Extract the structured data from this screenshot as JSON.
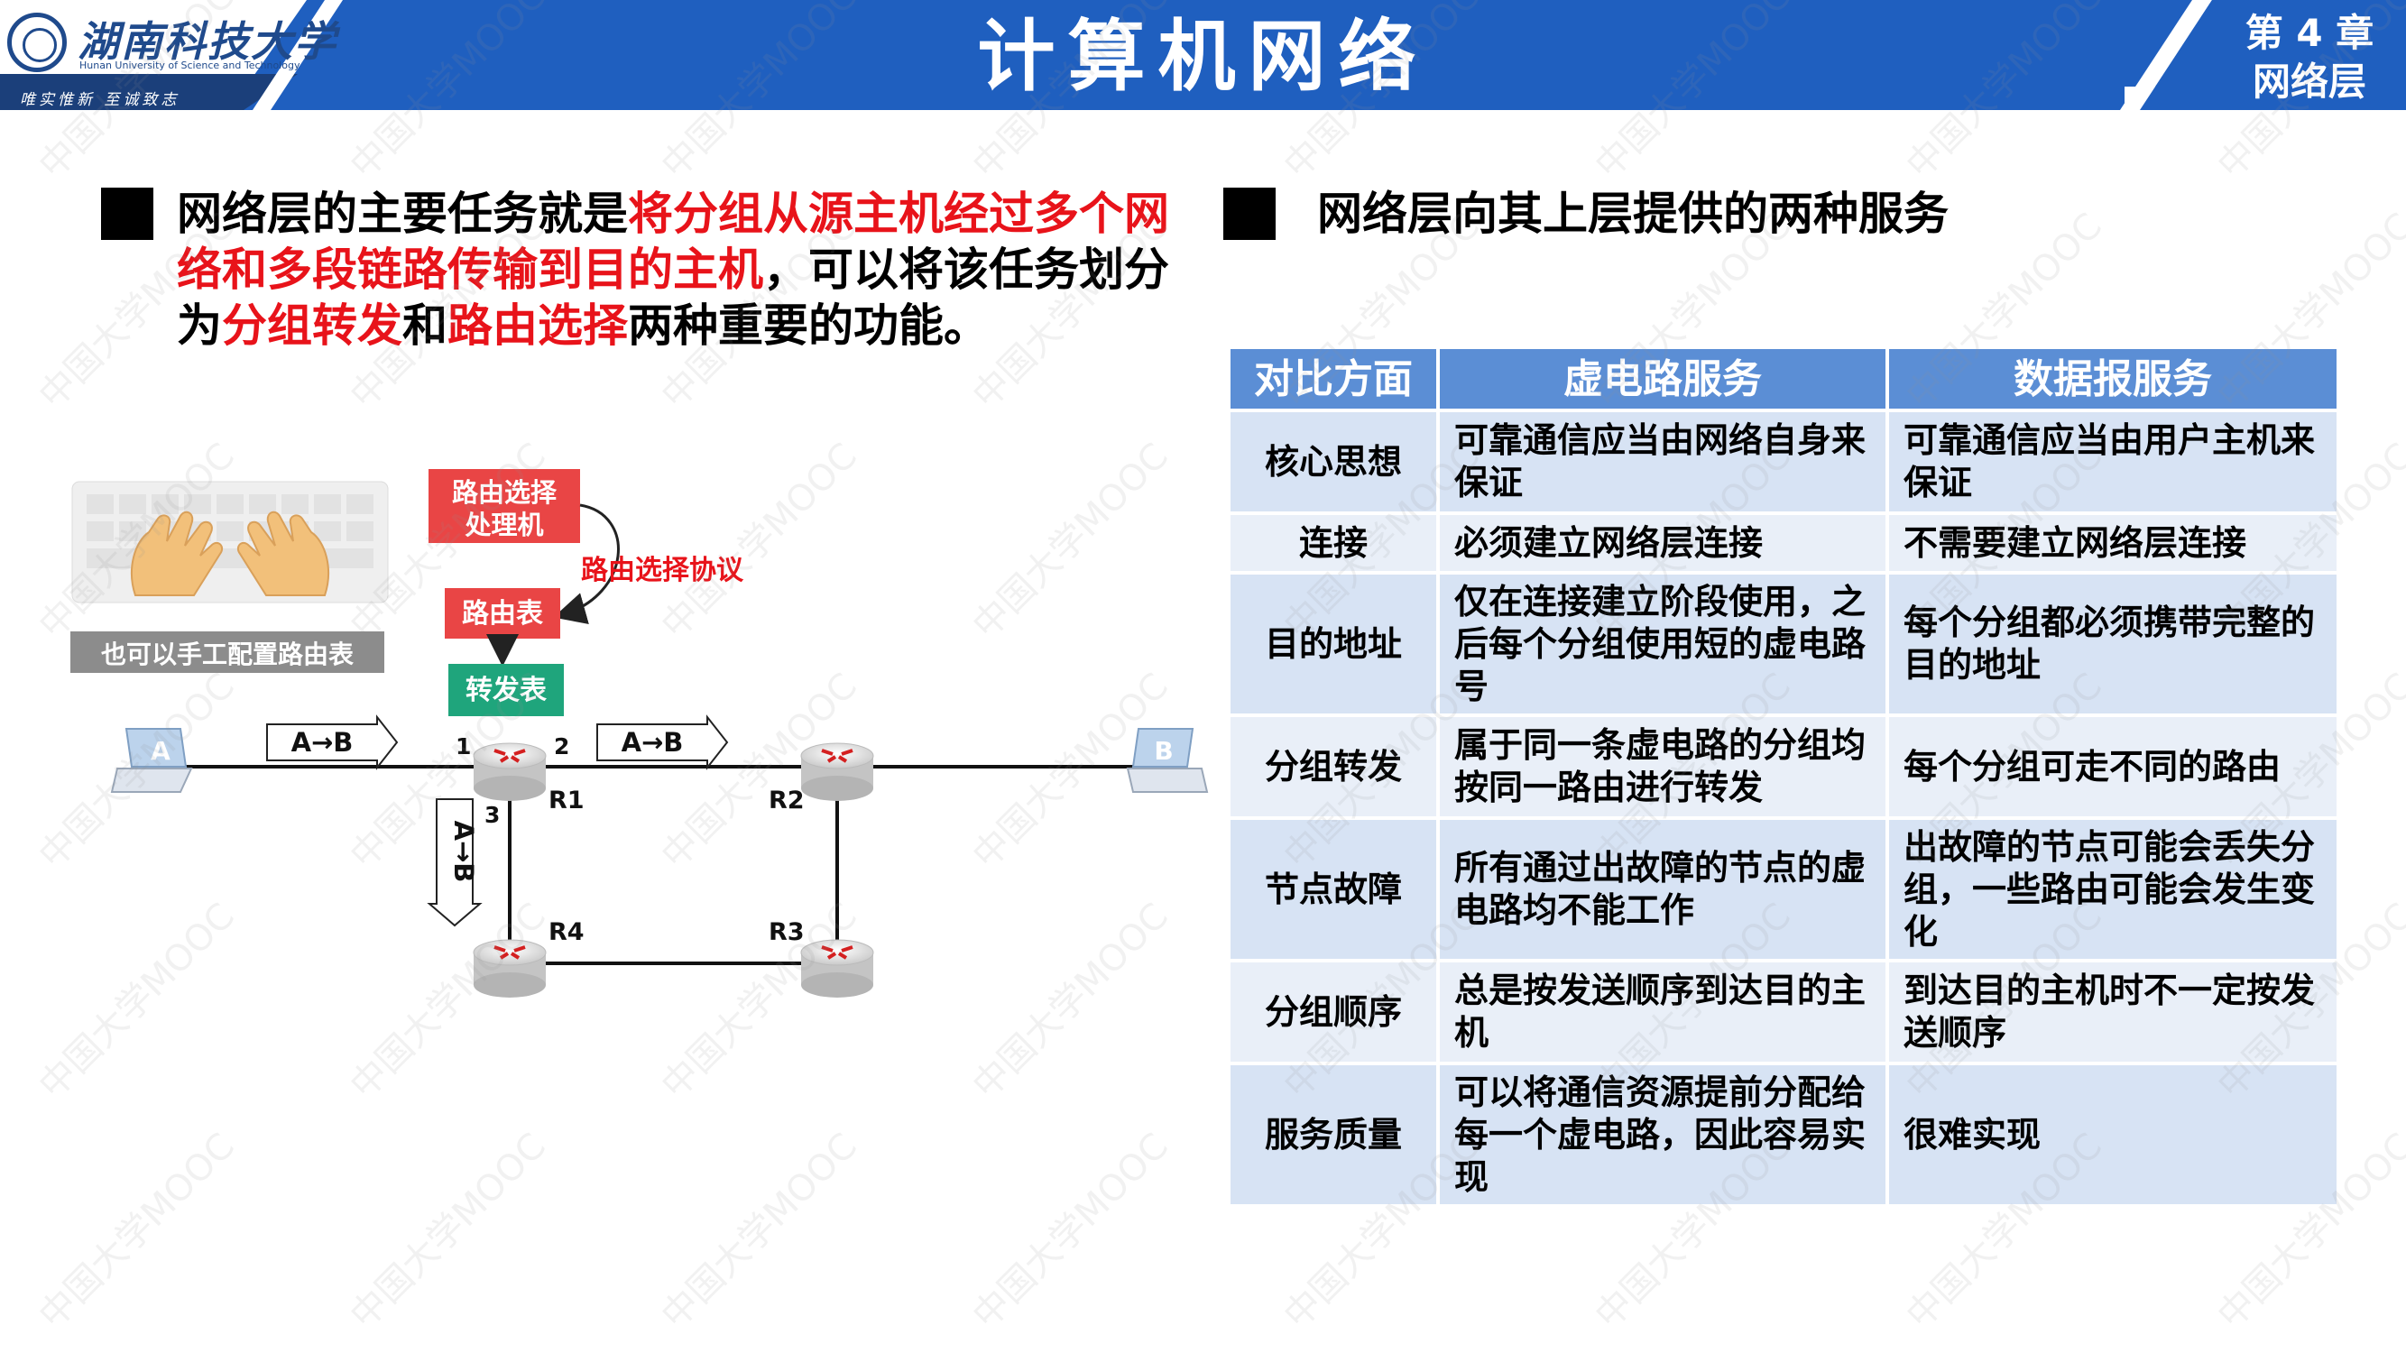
{
  "header": {
    "school_name": "湖南科技大学",
    "school_english": "Hunan University of Science and Technology",
    "motto": "唯实惟新  至诚致志",
    "title": "计算机网络",
    "chapter_line1": "第 4 章",
    "chapter_line2": "网络层"
  },
  "watermark": "中国大学MOOC",
  "left": {
    "para_parts": [
      {
        "text": "网络层的主要任务就是",
        "highlight": false
      },
      {
        "text": "将分组从源主机经过多个网络和多段链路传输到目的主机",
        "highlight": true
      },
      {
        "text": "，可以将该任务划分为",
        "highlight": false
      },
      {
        "text": "分组转发",
        "highlight": true
      },
      {
        "text": "和",
        "highlight": false
      },
      {
        "text": "路由选择",
        "highlight": true
      },
      {
        "text": "两种重要的功能。",
        "highlight": false
      }
    ],
    "lines": [
      [
        {
          "t": "网络层的主要任务就是",
          "r": false
        },
        {
          "t": "将分组从源主机经过多个网",
          "r": true
        }
      ],
      [
        {
          "t": "络和多段链路传输到目的主机",
          "r": true
        },
        {
          "t": "，可以将该任务划分",
          "r": false
        }
      ],
      [
        {
          "t": "为",
          "r": false
        },
        {
          "t": "分组转发",
          "r": true
        },
        {
          "t": "和",
          "r": false
        },
        {
          "t": "路由选择",
          "r": true
        },
        {
          "t": "两种重要的功能。",
          "r": false
        }
      ]
    ]
  },
  "diagram": {
    "routing_processor": [
      "路由选择",
      "处理机"
    ],
    "routing_protocol": "路由选择协议",
    "routing_table": "路由表",
    "forwarding_table": "转发表",
    "manual_config": "也可以手工配置路由表",
    "host_a": "A",
    "host_b": "B",
    "packet_label": "A→B",
    "ports": [
      "1",
      "2",
      "3"
    ],
    "routers": [
      "R1",
      "R2",
      "R3",
      "R4"
    ]
  },
  "right": {
    "heading": "网络层向其上层提供的两种服务",
    "table": {
      "headers": [
        "对比方面",
        "虚电路服务",
        "数据报服务"
      ],
      "rows": [
        {
          "aspect": "核心思想",
          "vc": "可靠通信应当由网络自身来保证",
          "dg": "可靠通信应当由用户主机来保证"
        },
        {
          "aspect": "连接",
          "vc": "必须建立网络层连接",
          "dg": "不需要建立网络层连接"
        },
        {
          "aspect": "目的地址",
          "vc": "仅在连接建立阶段使用，之后每个分组使用短的虚电路号",
          "dg": "每个分组都必须携带完整的目的地址"
        },
        {
          "aspect": "分组转发",
          "vc": "属于同一条虚电路的分组均按同一路由进行转发",
          "dg": "每个分组可走不同的路由"
        },
        {
          "aspect": "节点故障",
          "vc": "所有通过出故障的节点的虚电路均不能工作",
          "dg": "出故障的节点可能会丢失分组，一些路由可能会发生变化"
        },
        {
          "aspect": "分组顺序",
          "vc": "总是按发送顺序到达目的主机",
          "dg": "到达目的主机时不一定按发送顺序"
        },
        {
          "aspect": "服务质量",
          "vc": "可以将通信资源提前分配给每一个虚电路，因此容易实现",
          "dg": "很难实现"
        }
      ]
    }
  },
  "colors": {
    "header_blue": "#1f5fbf",
    "highlight_red": "#e8131a",
    "table_header": "#5b8ed5",
    "table_row_odd": "#d7e3f4",
    "table_row_even": "#e9eff8"
  }
}
